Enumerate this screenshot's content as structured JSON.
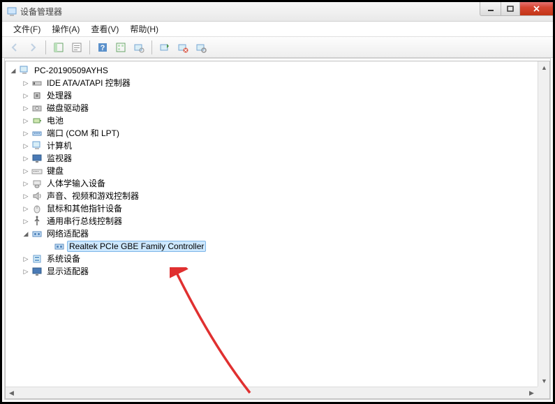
{
  "window": {
    "title": "设备管理器"
  },
  "menu": {
    "file": "文件(F)",
    "action": "操作(A)",
    "view": "查看(V)",
    "help": "帮助(H)"
  },
  "tree": {
    "root": "PC-20190509AYHS",
    "items": [
      {
        "label": "IDE ATA/ATAPI 控制器",
        "icon": "ide"
      },
      {
        "label": "处理器",
        "icon": "cpu"
      },
      {
        "label": "磁盘驱动器",
        "icon": "disk"
      },
      {
        "label": "电池",
        "icon": "battery"
      },
      {
        "label": "端口 (COM 和 LPT)",
        "icon": "port"
      },
      {
        "label": "计算机",
        "icon": "computer"
      },
      {
        "label": "监视器",
        "icon": "monitor"
      },
      {
        "label": "键盘",
        "icon": "keyboard"
      },
      {
        "label": "人体学输入设备",
        "icon": "hid"
      },
      {
        "label": "声音、视频和游戏控制器",
        "icon": "sound"
      },
      {
        "label": "鼠标和其他指针设备",
        "icon": "mouse"
      },
      {
        "label": "通用串行总线控制器",
        "icon": "usb"
      },
      {
        "label": "网络适配器",
        "icon": "network",
        "expanded": true,
        "children": [
          {
            "label": "Realtek PCIe GBE Family Controller",
            "icon": "nic",
            "selected": true
          }
        ]
      },
      {
        "label": "系统设备",
        "icon": "system"
      },
      {
        "label": "显示适配器",
        "icon": "display"
      }
    ]
  }
}
